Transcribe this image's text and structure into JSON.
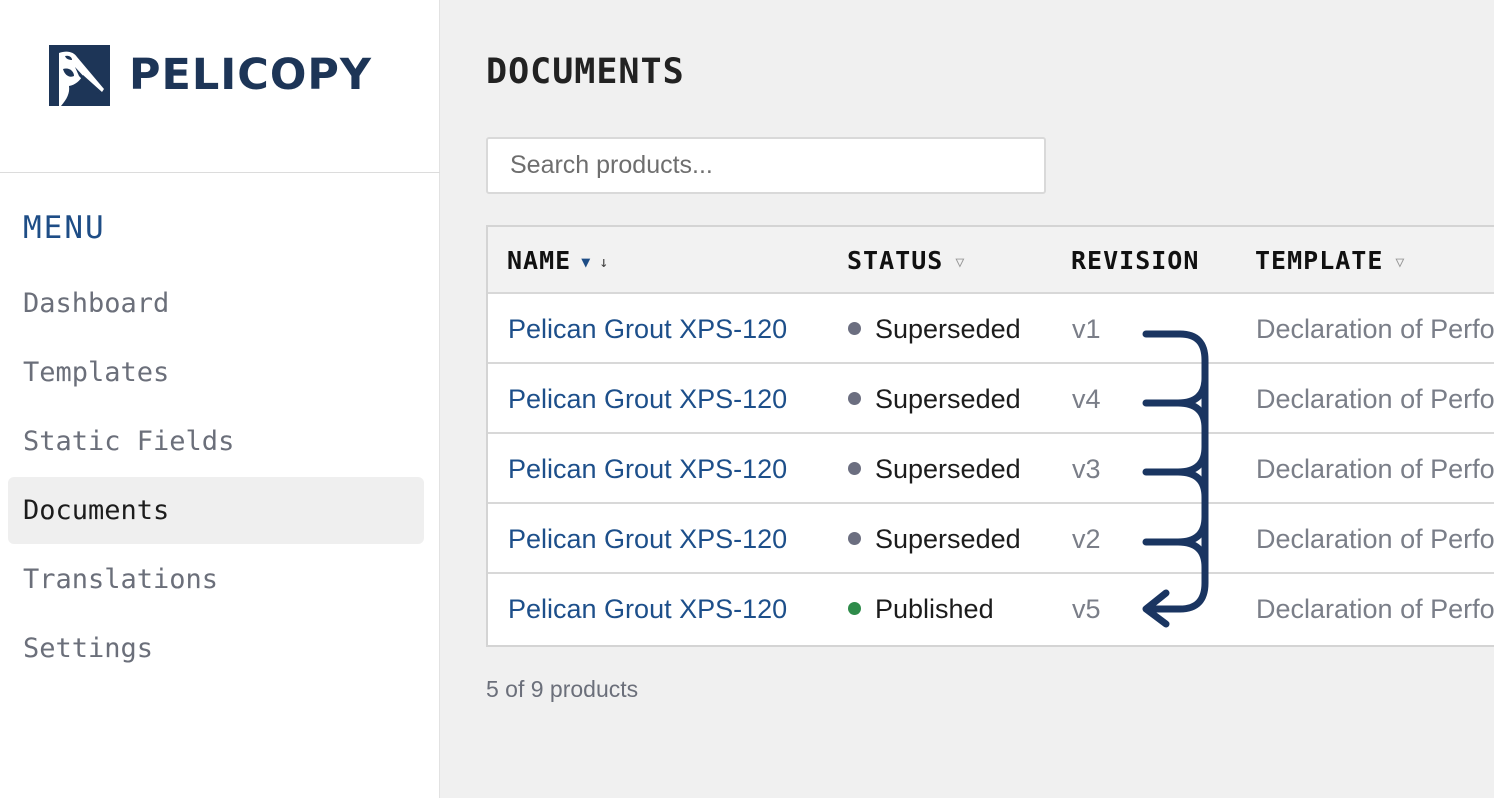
{
  "brand": {
    "name": "PELICOPY",
    "logo_icon": "pelican-icon",
    "color": "#1d3557"
  },
  "sidebar": {
    "menu_heading": "MENU",
    "items": [
      {
        "label": "Dashboard",
        "active": false
      },
      {
        "label": "Templates",
        "active": false
      },
      {
        "label": "Static Fields",
        "active": false
      },
      {
        "label": "Documents",
        "active": true
      },
      {
        "label": "Translations",
        "active": false
      },
      {
        "label": "Settings",
        "active": false
      }
    ]
  },
  "main": {
    "title": "DOCUMENTS",
    "search": {
      "placeholder": "Search products...",
      "value": ""
    },
    "table": {
      "columns": {
        "name": "NAME",
        "name_sort_icon": "▼",
        "name_sort_dir": "↓",
        "status": "STATUS",
        "status_filter_icon": "▽",
        "revision": "REVISION",
        "template": "TEMPLATE",
        "template_filter_icon": "▽"
      },
      "rows": [
        {
          "name": "Pelican Grout XPS-120",
          "status": "Superseded",
          "revision": "v1",
          "template": "Declaration of Performance"
        },
        {
          "name": "Pelican Grout XPS-120",
          "status": "Superseded",
          "revision": "v4",
          "template": "Declaration of Performance"
        },
        {
          "name": "Pelican Grout XPS-120",
          "status": "Superseded",
          "revision": "v3",
          "template": "Declaration of Performance"
        },
        {
          "name": "Pelican Grout XPS-120",
          "status": "Superseded",
          "revision": "v2",
          "template": "Declaration of Performance"
        },
        {
          "name": "Pelican Grout XPS-120",
          "status": "Published",
          "revision": "v5",
          "template": "Declaration of Performance"
        }
      ]
    },
    "count_text": "5 of 9 products"
  },
  "colors": {
    "accent": "#1d4f8a",
    "status_superseded": "#6b6e80",
    "status_published": "#2e8b4a",
    "arrow": "#1a3561"
  }
}
